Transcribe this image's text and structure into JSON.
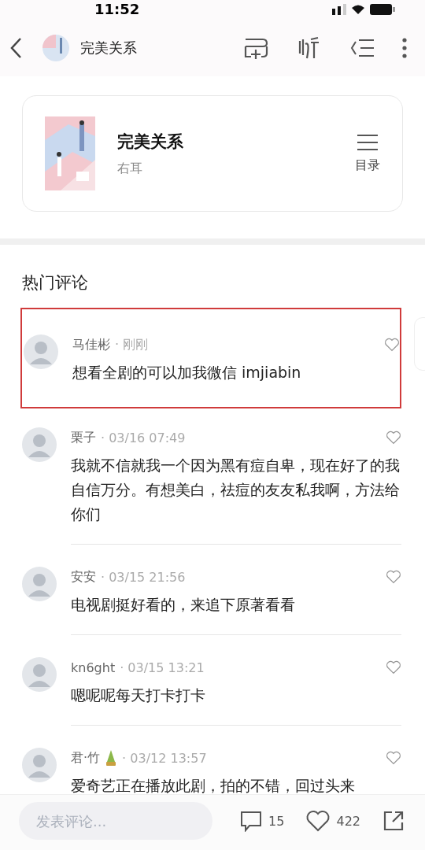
{
  "status_bar": {
    "time": "11:52"
  },
  "header": {
    "title": "完美关系"
  },
  "book": {
    "title": "完美关系",
    "author": "右耳",
    "toc_label": "目录"
  },
  "section_title": "热门评论",
  "comments": [
    {
      "user": "马佳彬",
      "time": "· 刚刚",
      "text": "想看全剧的可以加我微信 imjiabin",
      "highlighted": true,
      "name_icon": false
    },
    {
      "user": "栗子",
      "time": "· 03/16 07:49",
      "text": "我就不信就我一个因为黑有痘自卑，现在好了的我自信万分。有想美白，祛痘的友友私我啊，方法给你们",
      "highlighted": false,
      "name_icon": false
    },
    {
      "user": "安安",
      "time": "· 03/15 21:56",
      "text": "电视剧挺好看的，来追下原著看看",
      "highlighted": false,
      "name_icon": false
    },
    {
      "user": "kn6ght",
      "time": "· 03/15 13:21",
      "text": "嗯呢呢每天打卡打卡",
      "highlighted": false,
      "name_icon": false
    },
    {
      "user": "君·竹",
      "time": "· 03/12 13:57",
      "text": "爱奇艺正在播放此剧，拍的不错，回过头来",
      "highlighted": false,
      "name_icon": true
    }
  ],
  "bottom_bar": {
    "placeholder": "发表评论...",
    "comment_count": "15",
    "like_count": "422"
  }
}
